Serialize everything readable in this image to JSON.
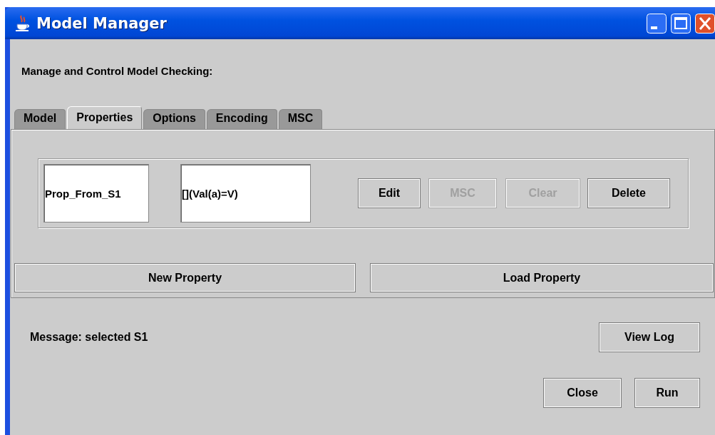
{
  "window": {
    "title": "Model Manager"
  },
  "heading": "Manage and Control Model Checking:",
  "tabs": [
    {
      "label": "Model",
      "selected": false
    },
    {
      "label": "Properties",
      "selected": true
    },
    {
      "label": "Options",
      "selected": false
    },
    {
      "label": "Encoding",
      "selected": false
    },
    {
      "label": "MSC",
      "selected": false
    }
  ],
  "property": {
    "name": "Prop_From_S1",
    "formula": "[](Val(a)=V)",
    "buttons": [
      {
        "label": "Edit",
        "disabled": false
      },
      {
        "label": "MSC",
        "disabled": true
      },
      {
        "label": "Clear",
        "disabled": true
      },
      {
        "label": "Delete",
        "disabled": false
      }
    ]
  },
  "panel_buttons": [
    "New Property",
    "Load Property"
  ],
  "message": "Message: selected S1",
  "log_button": "View Log",
  "buttons": [
    "Close",
    "Run"
  ]
}
